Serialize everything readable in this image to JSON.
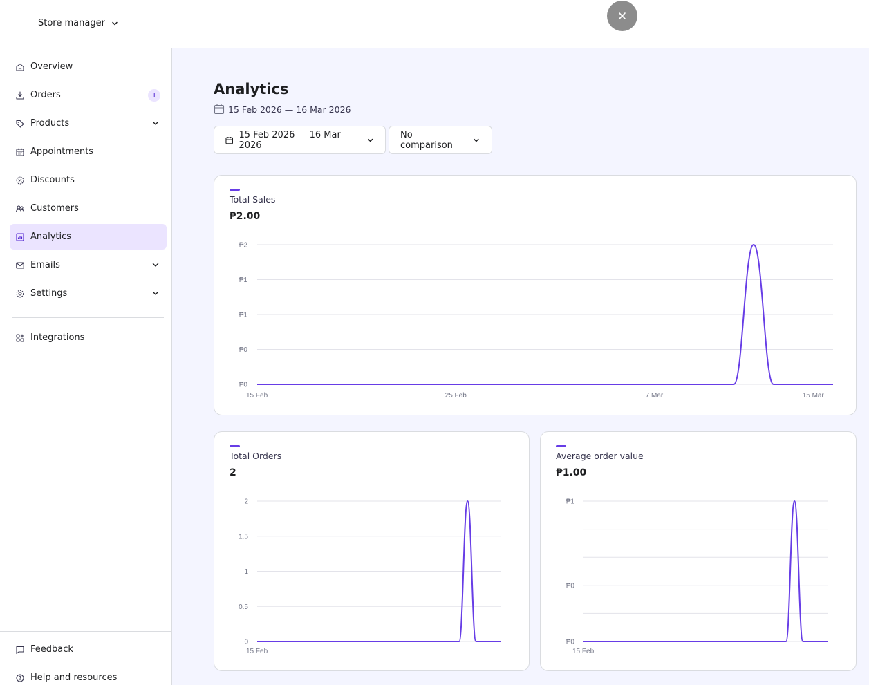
{
  "header": {
    "store_switch_label": "Store manager"
  },
  "sidebar": {
    "items": [
      {
        "label": "Overview",
        "icon": "home-icon"
      },
      {
        "label": "Orders",
        "icon": "download-icon",
        "badge": "1"
      },
      {
        "label": "Products",
        "icon": "tag-icon",
        "expandable": true
      },
      {
        "label": "Appointments",
        "icon": "calendar-icon"
      },
      {
        "label": "Discounts",
        "icon": "discount-icon"
      },
      {
        "label": "Customers",
        "icon": "users-icon"
      },
      {
        "label": "Analytics",
        "icon": "chart-icon",
        "active": true
      },
      {
        "label": "Emails",
        "icon": "mail-icon",
        "expandable": true
      },
      {
        "label": "Settings",
        "icon": "gear-icon",
        "expandable": true
      },
      {
        "label": "Integrations",
        "icon": "grid-plus-icon"
      }
    ],
    "bottom": [
      {
        "label": "Feedback",
        "icon": "chat-icon"
      },
      {
        "label": "Help and resources",
        "icon": "help-icon"
      }
    ]
  },
  "page": {
    "title": "Analytics",
    "date_range_text": "15 Feb 2026 — 16 Mar 2026"
  },
  "filters": {
    "date_range_label": "15 Feb 2026 — 16 Mar 2026",
    "comparison_label": "No comparison"
  },
  "colors": {
    "accent": "#673de6",
    "active_bg": "#ebe4ff",
    "main_bg": "#f4f5ff",
    "grid": "#e3e3ea"
  },
  "cards": {
    "total_sales": {
      "label": "Total Sales",
      "value": "₱2.00"
    },
    "total_orders": {
      "label": "Total Orders",
      "value": "2"
    },
    "avg_order_value": {
      "label": "Average order value",
      "value": "₱1.00"
    }
  },
  "chart_data": [
    {
      "type": "line",
      "title": "Total Sales",
      "x_tick_labels": [
        "15 Feb",
        "25 Feb",
        "7 Mar",
        "15 Mar"
      ],
      "y_tick_labels": [
        "₱2",
        "₱1",
        "₱1",
        "₱0",
        "₱0"
      ],
      "ylim": [
        0,
        2
      ],
      "x": [
        "2026-02-15",
        "2026-03-11",
        "2026-03-12",
        "2026-03-13",
        "2026-03-16"
      ],
      "series": [
        {
          "values": [
            0,
            0,
            2,
            0,
            0
          ]
        }
      ]
    },
    {
      "type": "line",
      "title": "Total Orders",
      "x_tick_labels": [
        "15 Feb"
      ],
      "y_tick_labels": [
        "2",
        "1.5",
        "1",
        "0.5",
        "0"
      ],
      "ylim": [
        0,
        2
      ],
      "x": [
        "2026-02-15",
        "2026-03-11",
        "2026-03-12",
        "2026-03-13",
        "2026-03-16"
      ],
      "series": [
        {
          "values": [
            0,
            0,
            2,
            0,
            0
          ]
        }
      ]
    },
    {
      "type": "line",
      "title": "Average order value",
      "x_tick_labels": [
        "15 Feb"
      ],
      "y_tick_labels": [
        "₱1",
        "",
        "",
        "₱0",
        "",
        "₱0"
      ],
      "ylim": [
        0,
        1
      ],
      "x": [
        "2026-02-15",
        "2026-03-11",
        "2026-03-12",
        "2026-03-13",
        "2026-03-16"
      ],
      "series": [
        {
          "values": [
            0,
            0,
            1,
            0,
            0
          ]
        }
      ]
    }
  ]
}
